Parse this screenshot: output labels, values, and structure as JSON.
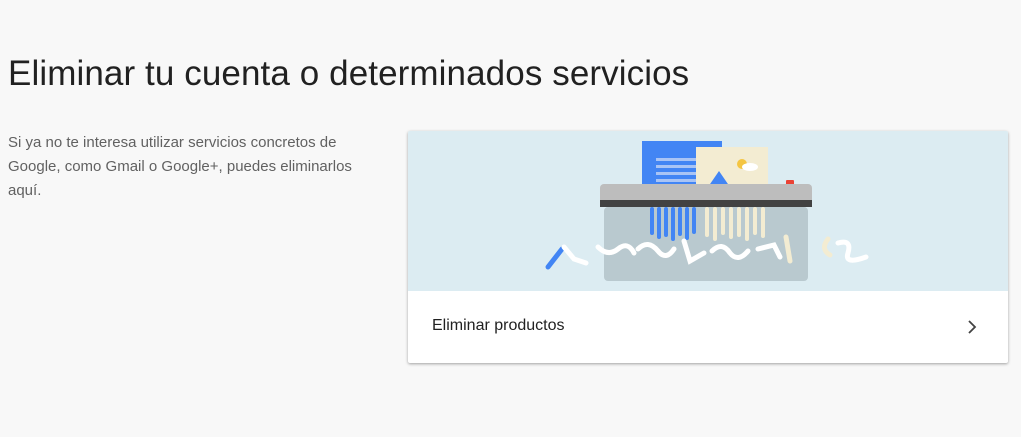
{
  "page": {
    "title": "Eliminar tu cuenta o determinados servicios",
    "description": "Si ya no te interesa utilizar servicios concretos de Google, como Gmail o Google+, puedes eliminarlos aquí."
  },
  "card": {
    "illustration_icon": "paper-shredder-illustration",
    "action_label": "Eliminar productos",
    "action_icon": "chevron-right-icon"
  },
  "colors": {
    "background": "#f8f8f8",
    "illustration_bg": "#dcecf2",
    "accent_blue": "#4285f4"
  }
}
